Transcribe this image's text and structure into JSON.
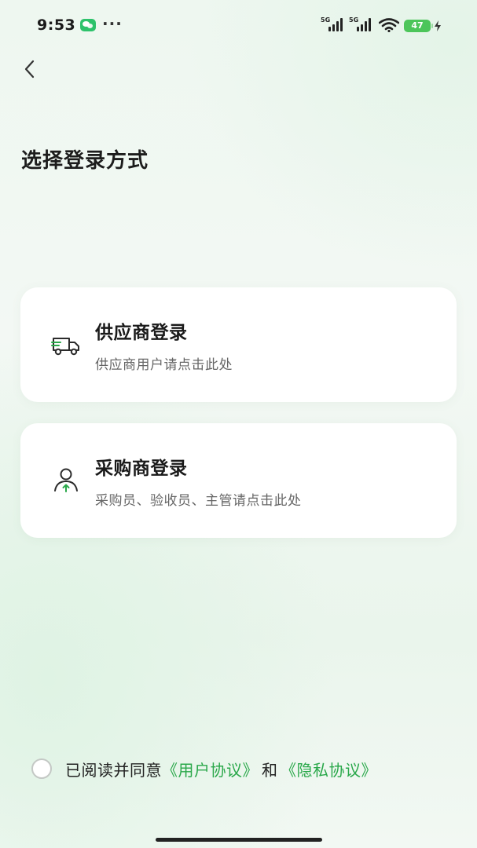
{
  "status_bar": {
    "time": "9:53",
    "more": "···",
    "signal_1_label": "5G",
    "signal_2_label": "5G",
    "battery_level": "47",
    "icons": [
      "wechat-icon",
      "signal-icon",
      "wifi-icon",
      "battery-icon",
      "charging-icon"
    ]
  },
  "header": {
    "back_icon": "chevron-left-icon",
    "title": "选择登录方式"
  },
  "cards": [
    {
      "icon": "truck-icon",
      "title": "供应商登录",
      "subtitle": "供应商用户请点击此处"
    },
    {
      "icon": "user-icon",
      "title": "采购商登录",
      "subtitle": "采购员、验收员、主管请点击此处"
    }
  ],
  "agreement": {
    "checked": false,
    "prefix": "已阅读并同意",
    "user_agreement": "《用户协议》",
    "conjunction": "和",
    "privacy_policy": "《隐私协议》"
  },
  "colors": {
    "accent_green": "#2aa84a",
    "battery_green": "#4cc55a",
    "background": "#eef7f0"
  }
}
